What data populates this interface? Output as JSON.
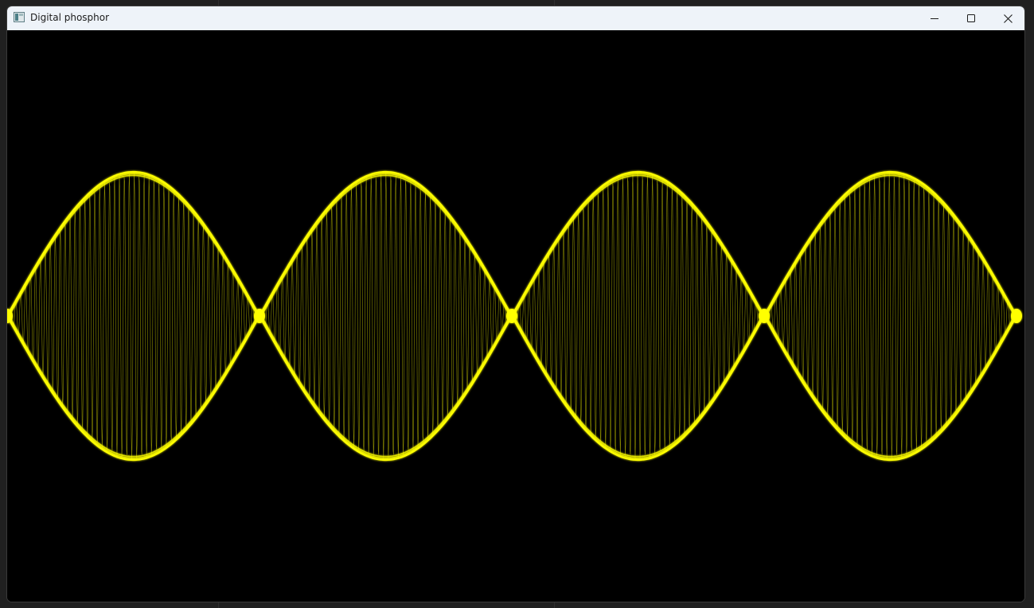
{
  "window": {
    "title": "Digital phosphor",
    "accent_color": "#ffff00",
    "background_color": "#000000"
  },
  "titlebar_controls": {
    "minimize_icon": "minimize-icon",
    "maximize_icon": "maximize-icon",
    "close_icon": "close-icon"
  },
  "waveform": {
    "description_color": "#ffff00",
    "lobes": 4
  }
}
